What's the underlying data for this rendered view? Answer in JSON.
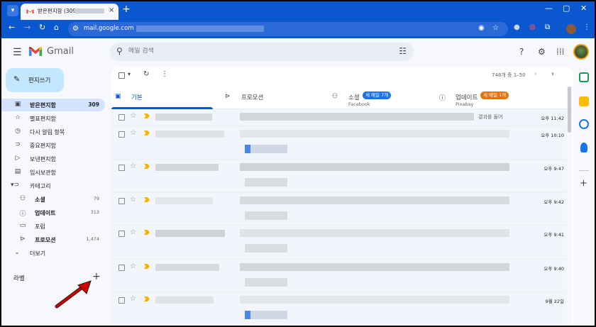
{
  "browser": {
    "tab_title": "받은편지함 (309)",
    "url": "mail.google.com",
    "icons": [
      "tab-search-icon",
      "back-arrow-icon",
      "forward-arrow-icon",
      "reload-icon",
      "home-icon",
      "site-info-icon",
      "eye-off-icon",
      "bookmark-star-icon",
      "extension-icon",
      "minimize-icon",
      "maximize-icon",
      "close-icon"
    ]
  },
  "header": {
    "app_name": "Gmail",
    "search_placeholder": "메일 검색"
  },
  "sidebar": {
    "compose": "편지쓰기",
    "items": [
      {
        "label": "받은편지함",
        "count": "309",
        "icon": "inbox-icon",
        "active": true
      },
      {
        "label": "별표편지함",
        "count": "",
        "icon": "star-icon"
      },
      {
        "label": "다시 알림 항목",
        "count": "",
        "icon": "clock-icon"
      },
      {
        "label": "중요편지함",
        "count": "",
        "icon": "important-icon"
      },
      {
        "label": "보낸편지함",
        "count": "",
        "icon": "send-icon"
      },
      {
        "label": "임시보관함",
        "count": "",
        "icon": "draft-icon"
      },
      {
        "label": "카테고리",
        "count": "",
        "icon": "label-icon"
      }
    ],
    "categories": [
      {
        "label": "소셜",
        "count": "79",
        "icon": "people-icon"
      },
      {
        "label": "업데이트",
        "count": "313",
        "icon": "info-icon"
      },
      {
        "label": "포럼",
        "count": "",
        "icon": "forum-icon"
      },
      {
        "label": "프로모션",
        "count": "1,474",
        "icon": "tag-icon"
      }
    ],
    "more": "더보기",
    "labels_title": "라벨",
    "labels_add": "+"
  },
  "toolbar": {
    "pager": "748개 중 1–50"
  },
  "tabs": [
    {
      "label": "기본",
      "active": true
    },
    {
      "label": "프로모션"
    },
    {
      "label": "소셜",
      "badge": "새 메일 7개",
      "sub": "Facebook",
      "badge_color": "#1a73e8"
    },
    {
      "label": "업데이트",
      "badge": "새 메일 1개",
      "sub": "Pixabay",
      "badge_color": "#e8710a"
    }
  ],
  "emails": [
    {
      "time": "오후 11:42",
      "hint": "결과를 들어"
    },
    {
      "time": "오후 10:10",
      "hint": ""
    },
    {
      "time": "오후 9:47",
      "hint": ""
    },
    {
      "time": "오후 9:42",
      "hint": ""
    },
    {
      "time": "오후 9:41",
      "hint": ""
    },
    {
      "time": "오후 9:40",
      "hint": ""
    },
    {
      "time": "9월 22일",
      "hint": ""
    }
  ],
  "colors": {
    "chrome_blue": "#0b57d0",
    "compose_bg": "#c2e7ff",
    "active_nav": "#d3e3fd",
    "annotation_arrow": "#d50000"
  }
}
